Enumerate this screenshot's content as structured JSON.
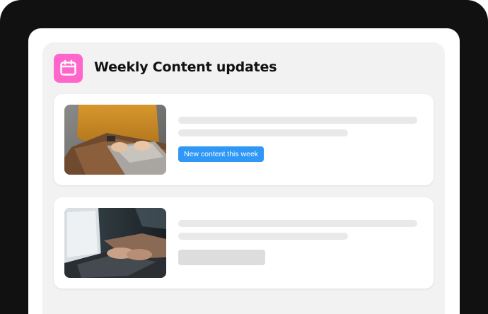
{
  "header": {
    "title": "Weekly Content updates",
    "icon": "calendar-icon",
    "icon_bg": "#ff66cc"
  },
  "cards": [
    {
      "badge_label": "New content this week",
      "badge_color": "#2f97f5",
      "thumbnail": "person-typing-laptop-photo"
    },
    {
      "thumbnail": "hands-on-laptop-keyboard-photo"
    }
  ],
  "colors": {
    "frame": "#111111",
    "panel": "#f2f2f2",
    "skeleton": "#e9e9e9"
  }
}
